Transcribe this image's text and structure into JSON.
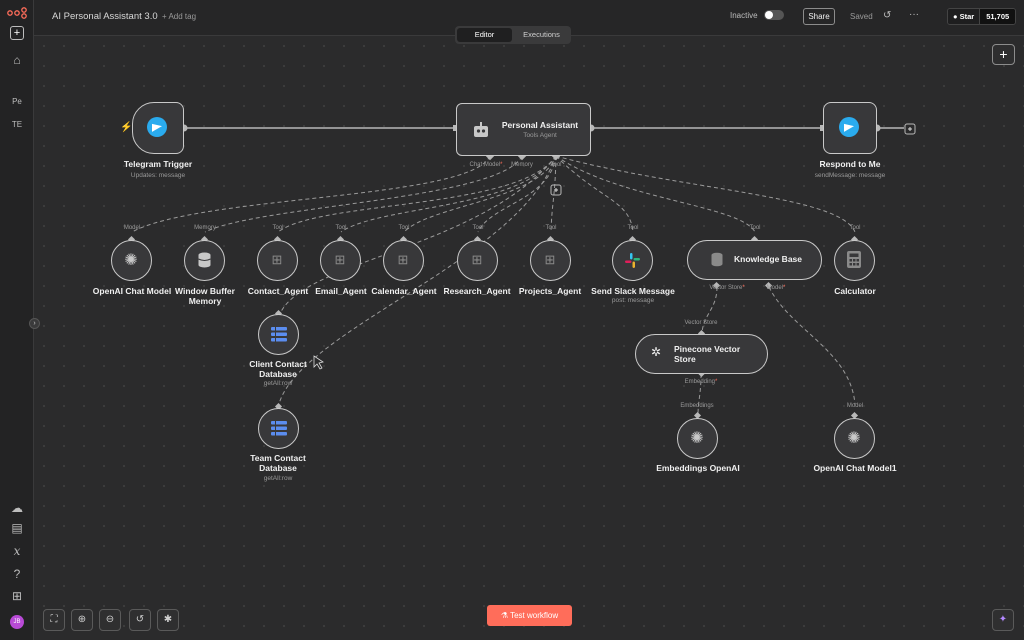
{
  "workflow": {
    "title": "AI Personal Assistant 3.0",
    "add_tag": "+ Add tag"
  },
  "header": {
    "active_label": "Inactive",
    "share_label": "Share",
    "saved_label": "Saved",
    "github_star": "Star",
    "github_count": "51,705"
  },
  "tabs": {
    "editor": "Editor",
    "executions": "Executions"
  },
  "sidebar": {
    "items": [
      "Pe",
      "TE"
    ]
  },
  "nodes": {
    "telegram_trigger": {
      "label": "Telegram Trigger",
      "sub": "Updates: message"
    },
    "personal_assistant": {
      "label": "Personal Assistant",
      "sub": "Tools Agent"
    },
    "respond": {
      "label": "Respond to Me",
      "sub": "sendMessage: message"
    },
    "openai_chat": {
      "label": "OpenAI Chat Model"
    },
    "window_memory": {
      "label": "Window Buffer Memory"
    },
    "contact_agent": {
      "label": "Contact_Agent"
    },
    "email_agent": {
      "label": "Email_Agent"
    },
    "calendar_agent": {
      "label": "Calendar_Agent"
    },
    "research_agent": {
      "label": "Research_Agent"
    },
    "projects_agent": {
      "label": "Projects_Agent"
    },
    "slack": {
      "label": "Send Slack Message",
      "sub": "post: message"
    },
    "knowledge_base": {
      "label": "Knowledge Base"
    },
    "calculator": {
      "label": "Calculator"
    },
    "client_db": {
      "label": "Client Contact Database",
      "sub": "getAll:row"
    },
    "team_db": {
      "label": "Team Contact Database",
      "sub": "getAll:row"
    },
    "pinecone": {
      "label": "Pinecone Vector Store"
    },
    "embeddings": {
      "label": "Embeddings OpenAI"
    },
    "openai_chat1": {
      "label": "OpenAI Chat Model1"
    }
  },
  "ports": {
    "chat_model": "Chat Model",
    "memory": "Memory",
    "tool": "Tool",
    "model": "Model",
    "vector_store": "Vector Store",
    "embedding": "Embedding",
    "embeddings": "Embeddings"
  },
  "footer": {
    "test_workflow": "Test workflow"
  },
  "colors": {
    "accent": "#ff6d5a",
    "telegram": "#2aabee",
    "canvas": "#2b2b2c"
  }
}
